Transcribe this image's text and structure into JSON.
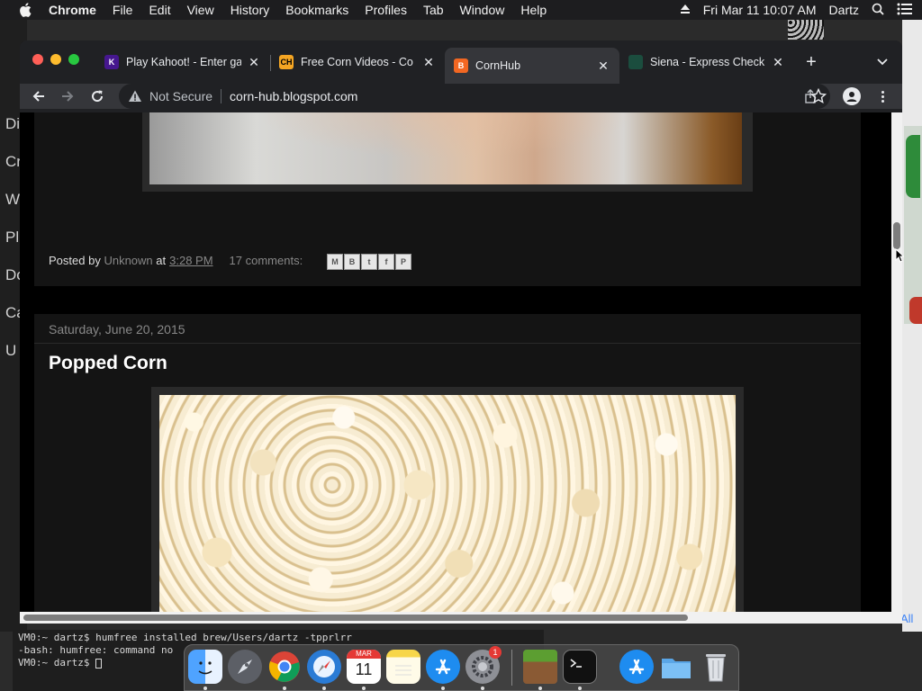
{
  "menubar": {
    "app_name": "Chrome",
    "items": [
      "File",
      "Edit",
      "View",
      "History",
      "Bookmarks",
      "Profiles",
      "Tab",
      "Window",
      "Help"
    ],
    "datetime": "Fri Mar 11  10:07 AM",
    "user": "Dartz"
  },
  "background": {
    "left_window_letters": [
      "Di",
      "Cr",
      "W",
      "Pl",
      "Do",
      "Ca",
      "U"
    ],
    "right_link": "All"
  },
  "browser": {
    "tabs": [
      {
        "title": "Play Kahoot! - Enter ga",
        "favicon_color": "#46178f",
        "active": false
      },
      {
        "title": "Free Corn Videos - Co",
        "favicon_color": "#f5a623",
        "favicon_text": "CH",
        "active": false
      },
      {
        "title": "CornHub",
        "favicon_color": "#f26722",
        "active": true
      },
      {
        "title": "Siena - Express Check",
        "favicon_color": "#1b4d3e",
        "active": false
      }
    ],
    "new_tab_label": "+",
    "security_label": "Not Secure",
    "url": "corn-hub.blogspot.com"
  },
  "page": {
    "post1": {
      "posted_by_label": "Posted by",
      "author": "Unknown",
      "at_label": "at",
      "time": "3:28 PM",
      "comments": "17 comments:",
      "share_buttons": [
        "M",
        "B",
        "t",
        "f",
        "P"
      ]
    },
    "post2": {
      "date": "Saturday, June 20, 2015",
      "title": "Popped Corn"
    }
  },
  "terminal": {
    "lines": [
      "VM0:~ dartz$ humfree installed brew/Users/dartz -tpprlrr",
      "-bash: humfree: command no",
      "VM0:~ dartz$ "
    ]
  },
  "dock": {
    "apps": [
      "Finder",
      "Launchpad",
      "Chrome",
      "Safari",
      "Calendar",
      "Notes",
      "App Store",
      "System Preferences",
      "Minecraft",
      "Terminal",
      "App Store Downloads",
      "Folder",
      "Trash"
    ],
    "calendar_month": "MAR",
    "calendar_day": "11",
    "badge_count": "1"
  },
  "colors": {
    "page_bg": "#000000",
    "post_bg": "#141414",
    "chrome_dark": "#202124",
    "active_tab": "#35363a"
  }
}
